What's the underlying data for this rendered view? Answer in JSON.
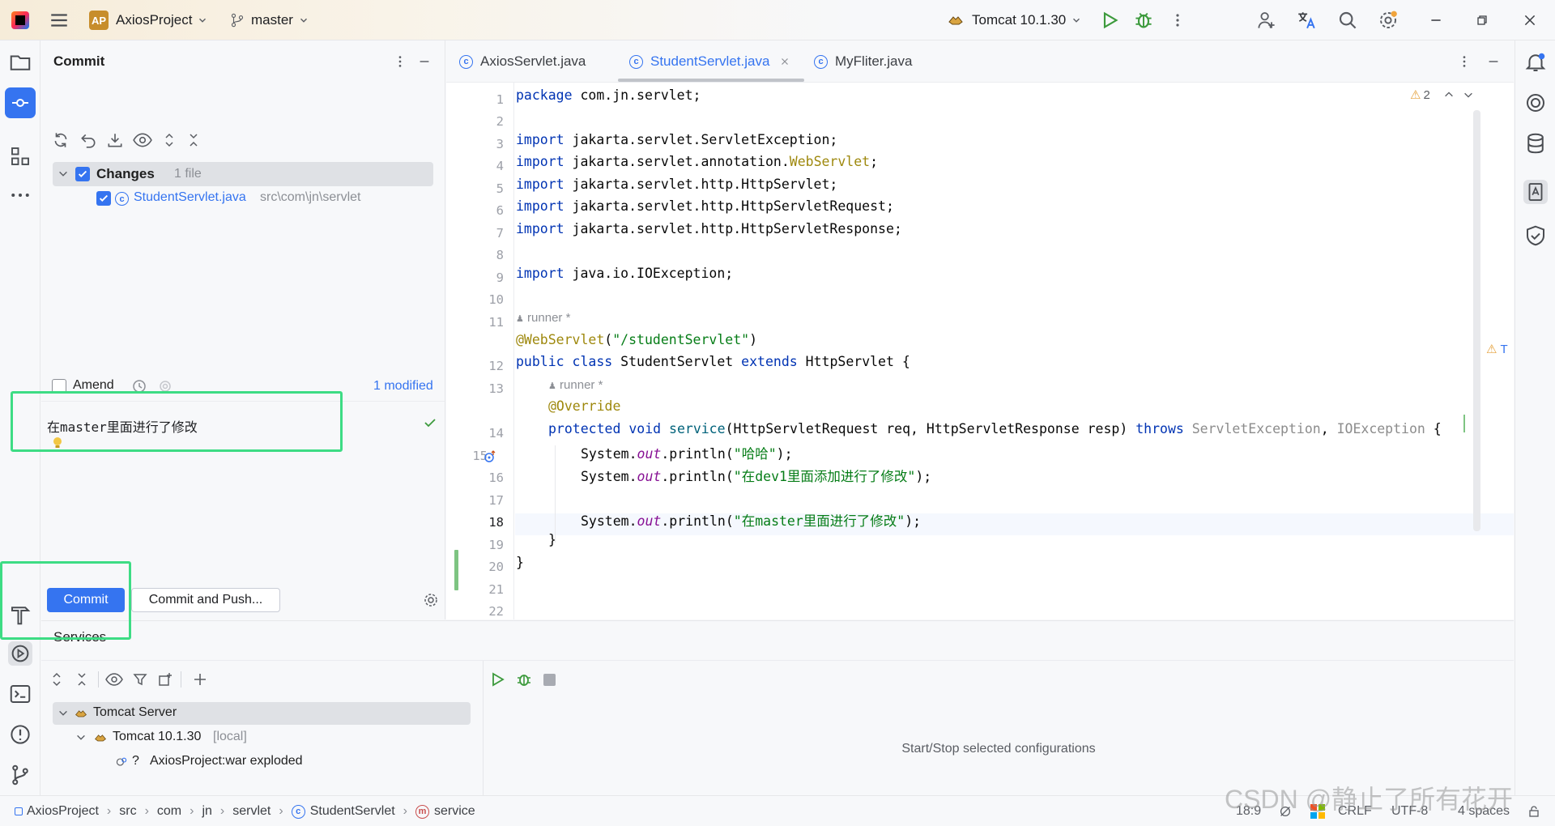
{
  "titlebar": {
    "project_badge": "AP",
    "project_name": "AxiosProject",
    "branch": "master",
    "run_config": "Tomcat 10.1.30"
  },
  "commit_panel": {
    "title": "Commit",
    "changes_label": "Changes",
    "changes_count": "1 file",
    "file_name": "StudentServlet.java",
    "file_path": "src\\com\\jn\\servlet",
    "amend_label": "Amend",
    "modified_label": "1 modified",
    "commit_message": "在master里面进行了修改",
    "commit_button": "Commit",
    "commit_push_button": "Commit and Push..."
  },
  "editor": {
    "tabs": [
      {
        "label": "AxiosServlet.java"
      },
      {
        "label": "StudentServlet.java"
      },
      {
        "label": "MyFliter.java"
      }
    ],
    "warning_count": "2",
    "hint_author": "runner *",
    "right_marker": "T",
    "line_numbers": [
      "1",
      "2",
      "3",
      "4",
      "5",
      "6",
      "7",
      "8",
      "9",
      "10",
      "11",
      "12",
      "13",
      "14",
      "15",
      "16",
      "17",
      "18",
      "19",
      "20",
      "21",
      "22"
    ],
    "code": {
      "l1_kw": "package",
      "l1_rest": " com.jn.servlet;",
      "l3_kw": "import",
      "l3_rest": " jakarta.servlet.ServletException;",
      "l4_kw": "import",
      "l4_rest": " jakarta.servlet.annotation.",
      "l4_ann": "WebServlet",
      "l4_end": ";",
      "l5_kw": "import",
      "l5_rest": " jakarta.servlet.http.HttpServlet;",
      "l6_kw": "import",
      "l6_rest": " jakarta.servlet.http.HttpServletRequest;",
      "l7_kw": "import",
      "l7_rest": " jakarta.servlet.http.HttpServletResponse;",
      "l9_kw": "import",
      "l9_rest": " java.io.IOException;",
      "l12_ann": "@WebServlet",
      "l12_p1": "(",
      "l12_str": "\"/studentServlet\"",
      "l12_p2": ")",
      "l13_kw1": "public class",
      "l13_mid": " StudentServlet ",
      "l13_kw2": "extends",
      "l13_end": " HttpServlet {",
      "l14_ann": "@Override",
      "l15_kw": "protected void",
      "l15_fn": " service",
      "l15_args": "(HttpServletRequest req, HttpServletResponse resp) ",
      "l15_throws": "throws",
      "l15_ex1": " ServletException",
      "l15_comma": ", ",
      "l15_ex2": "IOException",
      "l15_end": " {",
      "l16_a": "System.",
      "l16_out": "out",
      "l16_b": ".println(",
      "l16_str": "\"哈哈\"",
      "l16_c": ");",
      "l17_a": "System.",
      "l17_out": "out",
      "l17_b": ".println(",
      "l17_str": "\"在dev1里面添加进行了修改\"",
      "l17_c": ");",
      "l19_a": "System.",
      "l19_out": "out",
      "l19_b": ".println(",
      "l19_str": "\"在master里面进行了修改\"",
      "l19_c": ");",
      "l20": "}",
      "l21": "}"
    }
  },
  "services": {
    "title": "Services",
    "tree": [
      {
        "label": "Tomcat Server"
      },
      {
        "label": "Tomcat 10.1.30",
        "suffix": "[local]"
      },
      {
        "label": "AxiosProject:war exploded",
        "prefix": "?"
      }
    ],
    "empty_text": "Start/Stop selected configurations"
  },
  "statusbar": {
    "breadcrumb": [
      "AxiosProject",
      "src",
      "com",
      "jn",
      "servlet",
      "StudentServlet",
      "service"
    ],
    "position": "18:9",
    "line_sep": "CRLF",
    "encoding": "UTF-8",
    "indent": "4 spaces",
    "watermark": "CSDN @静止了所有花开"
  }
}
